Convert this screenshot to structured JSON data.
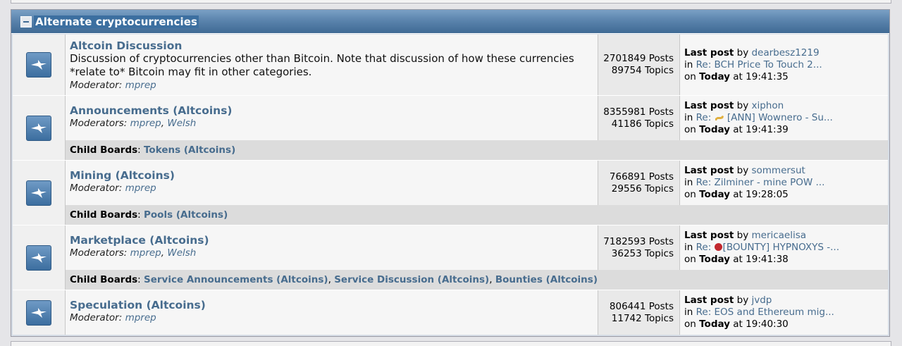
{
  "category": {
    "title": "Alternate cryptocurrencies"
  },
  "boards": [
    {
      "name": "Altcoin Discussion",
      "description": "Discussion of cryptocurrencies other than Bitcoin. Note that discussion of how these currencies *relate to* Bitcoin may fit in other categories.",
      "mod_label": "Moderator:",
      "moderators": [
        "mprep"
      ],
      "posts": "2701849 Posts",
      "topics": "89754 Topics",
      "last_post": {
        "label": "Last post",
        "by": "by",
        "user": "dearbesz1219",
        "in": "in",
        "topic": "Re: BCH Price To Touch 2...",
        "on": "on",
        "day": "Today",
        "time": "at 19:41:35"
      }
    },
    {
      "name": "Announcements (Altcoins)",
      "mod_label": "Moderators:",
      "moderators": [
        "mprep",
        "Welsh"
      ],
      "posts": "8355981 Posts",
      "topics": "41186 Topics",
      "last_post": {
        "label": "Last post",
        "by": "by",
        "user": "xiphon",
        "in": "in",
        "topic_prefix": "Re:",
        "topic": "[ANN] Wownero - Su...",
        "on": "on",
        "day": "Today",
        "time": "at 19:41:39"
      },
      "child_label": "Child Boards",
      "children": [
        "Tokens (Altcoins)"
      ]
    },
    {
      "name": "Mining (Altcoins)",
      "mod_label": "Moderator:",
      "moderators": [
        "mprep"
      ],
      "posts": "766891 Posts",
      "topics": "29556 Topics",
      "last_post": {
        "label": "Last post",
        "by": "by",
        "user": "sommersut",
        "in": "in",
        "topic": "Re: Zilminer - mine POW ...",
        "on": "on",
        "day": "Today",
        "time": "at 19:28:05"
      },
      "child_label": "Child Boards",
      "children": [
        "Pools (Altcoins)"
      ]
    },
    {
      "name": "Marketplace (Altcoins)",
      "mod_label": "Moderators:",
      "moderators": [
        "mprep",
        "Welsh"
      ],
      "posts": "7182593 Posts",
      "topics": "36253 Topics",
      "last_post": {
        "label": "Last post",
        "by": "by",
        "user": "mericaelisa",
        "in": "in",
        "topic_prefix": "Re:",
        "topic": "[BOUNTY] HYPNOXYS -...",
        "on": "on",
        "day": "Today",
        "time": "at 19:41:38"
      },
      "child_label": "Child Boards",
      "children": [
        "Service Announcements (Altcoins)",
        "Service Discussion (Altcoins)",
        "Bounties (Altcoins)"
      ]
    },
    {
      "name": "Speculation (Altcoins)",
      "mod_label": "Moderator:",
      "moderators": [
        "mprep"
      ],
      "posts": "806441 Posts",
      "topics": "11742 Topics",
      "last_post": {
        "label": "Last post",
        "by": "by",
        "user": "jvdp",
        "in": "in",
        "topic": "Re: EOS and Ethereum mig...",
        "on": "on",
        "day": "Today",
        "time": "at 19:40:30"
      }
    }
  ],
  "icons": {
    "board": "board-icon",
    "collapse": "collapse-icon",
    "dog": "dog-emoji-icon",
    "red_circle": "red-circle-icon"
  }
}
